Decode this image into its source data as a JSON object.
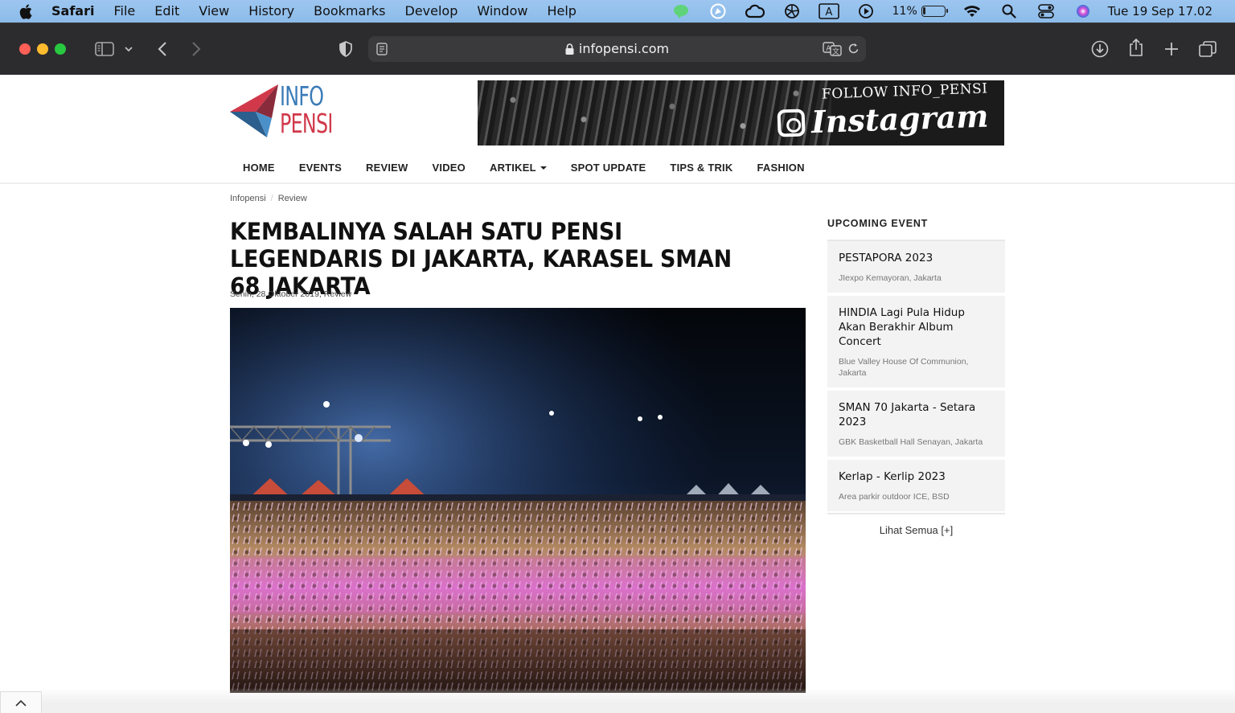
{
  "menubar": {
    "app_name": "Safari",
    "items": [
      "File",
      "Edit",
      "View",
      "History",
      "Bookmarks",
      "Develop",
      "Window",
      "Help"
    ],
    "battery_percent": "11%",
    "battery_level": 0.11,
    "datetime": "Tue 19 Sep  17.02"
  },
  "browser": {
    "url": "infopensi.com"
  },
  "site": {
    "logo_line1": "INFO",
    "logo_line2": "PENSI",
    "banner_follow": "FOLLOW INFO_PENSI",
    "banner_brand": "Instagram",
    "nav": [
      "HOME",
      "EVENTS",
      "REVIEW",
      "VIDEO",
      "ARTIKEL",
      "SPOT UPDATE",
      "TIPS & TRIK",
      "FASHION"
    ]
  },
  "article": {
    "breadcrumb": [
      "Infopensi",
      "Review"
    ],
    "breadcrumb_sep": "/",
    "title": "KEMBALINYA SALAH SATU PENSI LEGENDARIS DI JAKARTA, KARASEL SMAN 68 JAKARTA",
    "meta": "Senin, 28 Oktober 2019, Review"
  },
  "sidebar": {
    "heading": "UPCOMING EVENT",
    "events": [
      {
        "title": "PESTAPORA 2023",
        "location": "JIexpo Kemayoran, Jakarta"
      },
      {
        "title": "HINDIA Lagi Pula Hidup Akan Berakhir Album Concert",
        "location": "Blue Valley House Of Communion, Jakarta"
      },
      {
        "title": "SMAN 70 Jakarta - Setara 2023",
        "location": "GBK Basketball Hall Senayan, Jakarta"
      },
      {
        "title": "Kerlap - Kerlip 2023",
        "location": "Area parkir outdoor ICE, BSD"
      }
    ],
    "see_all": "Lihat Semua [+]"
  },
  "colors": {
    "menubar_bg": "#8dbbe9",
    "toolbar_bg": "#2c2c2e",
    "logo_blue": "#3a7bb8",
    "logo_red": "#d1394b",
    "crowd_pink": "#e25bd6"
  }
}
